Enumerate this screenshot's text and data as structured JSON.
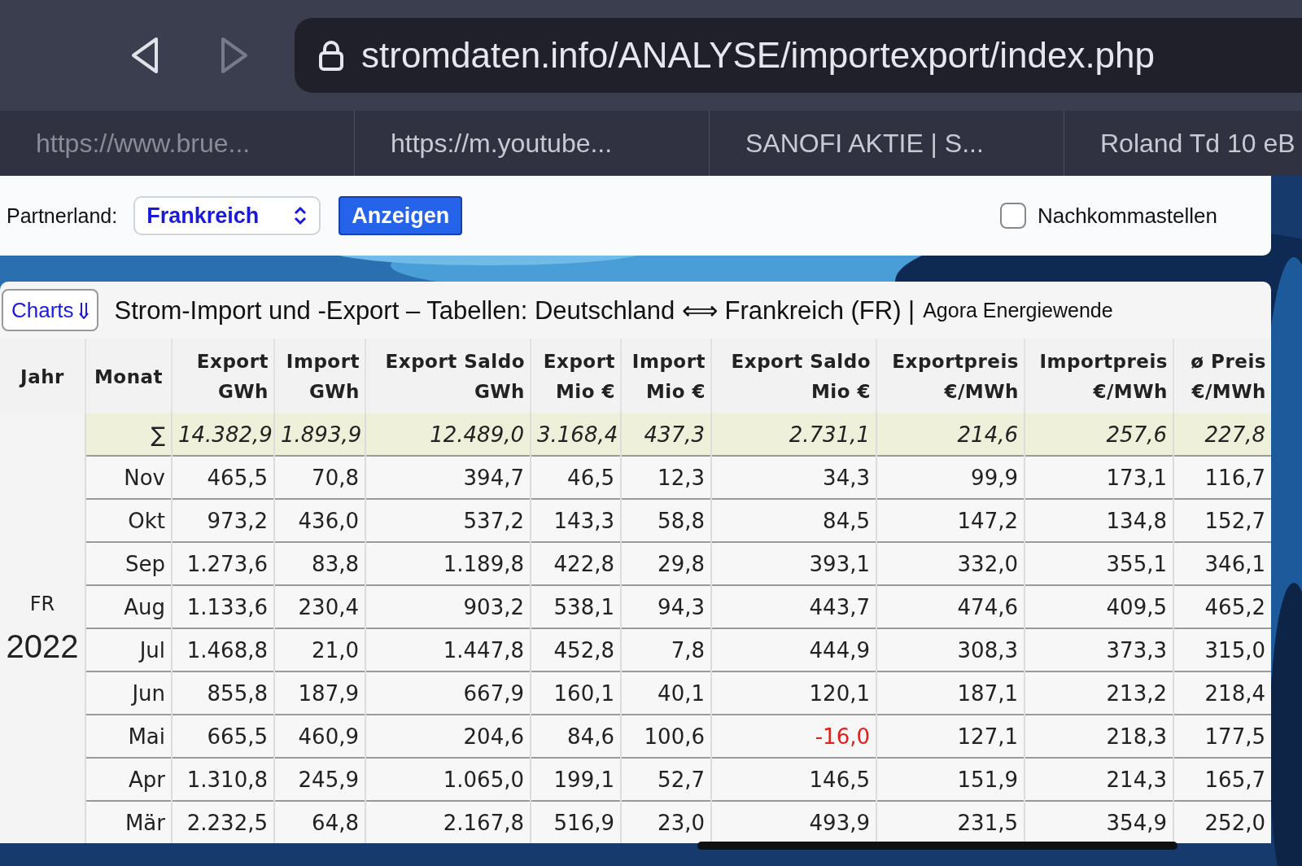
{
  "browser": {
    "url": "stromdaten.info/ANALYSE/importexport/index.php",
    "forward_disabled": true,
    "tabs": [
      {
        "label": "https://www.brue..."
      },
      {
        "label": "https://m.youtube..."
      },
      {
        "label": "SANOFI AKTIE | S..."
      },
      {
        "label": "Roland Td 10 eB"
      }
    ]
  },
  "form": {
    "partner_label": "Partnerland:",
    "partner_value": "Frankreich",
    "show_button": "Anzeigen",
    "decimals_label": "Nachkommastellen",
    "decimals_checked": false
  },
  "title_bar": {
    "charts_button": "Charts",
    "title": "Strom-Import und -Export – Tabellen: Deutschland ⟺ Frankreich (FR) |",
    "source": "Agora Energiewende"
  },
  "table": {
    "year_header": "Jahr",
    "month_header": "Monat",
    "columns": [
      {
        "line1": "Export",
        "line2": "GWh"
      },
      {
        "line1": "Import",
        "line2": "GWh"
      },
      {
        "line1": "Export Saldo",
        "line2": "GWh"
      },
      {
        "line1": "Export",
        "line2": "Mio €"
      },
      {
        "line1": "Import",
        "line2": "Mio €"
      },
      {
        "line1": "Export Saldo",
        "line2": "Mio €"
      },
      {
        "line1": "Exportpreis",
        "line2": "€/MWh"
      },
      {
        "line1": "Importpreis",
        "line2": "€/MWh"
      },
      {
        "line1": "ø Preis",
        "line2": "€/MWh"
      }
    ],
    "sum_row": {
      "label": "∑",
      "values": [
        "14.382,9",
        "1.893,9",
        "12.489,0",
        "3.168,4",
        "437,3",
        "2.731,1",
        "214,6",
        "257,6",
        "227,8"
      ]
    },
    "year": {
      "country": "FR",
      "year": "2022"
    },
    "rows": [
      {
        "month": "Nov",
        "values": [
          "465,5",
          "70,8",
          "394,7",
          "46,5",
          "12,3",
          "34,3",
          "99,9",
          "173,1",
          "116,7"
        ]
      },
      {
        "month": "Okt",
        "values": [
          "973,2",
          "436,0",
          "537,2",
          "143,3",
          "58,8",
          "84,5",
          "147,2",
          "134,8",
          "152,7"
        ]
      },
      {
        "month": "Sep",
        "values": [
          "1.273,6",
          "83,8",
          "1.189,8",
          "422,8",
          "29,8",
          "393,1",
          "332,0",
          "355,1",
          "346,1"
        ]
      },
      {
        "month": "Aug",
        "values": [
          "1.133,6",
          "230,4",
          "903,2",
          "538,1",
          "94,3",
          "443,7",
          "474,6",
          "409,5",
          "465,2"
        ]
      },
      {
        "month": "Jul",
        "values": [
          "1.468,8",
          "21,0",
          "1.447,8",
          "452,8",
          "7,8",
          "444,9",
          "308,3",
          "373,3",
          "315,0"
        ]
      },
      {
        "month": "Jun",
        "values": [
          "855,8",
          "187,9",
          "667,9",
          "160,1",
          "40,1",
          "120,1",
          "187,1",
          "213,2",
          "218,4"
        ]
      },
      {
        "month": "Mai",
        "values": [
          "665,5",
          "460,9",
          "204,6",
          "84,6",
          "100,6",
          {
            "text": "-16,0",
            "negative": true
          },
          "127,1",
          "218,3",
          "177,5"
        ]
      },
      {
        "month": "Apr",
        "values": [
          "1.310,8",
          "245,9",
          "1.065,0",
          "199,1",
          "52,7",
          "146,5",
          "151,9",
          "214,3",
          "165,7"
        ]
      },
      {
        "month": "Mär",
        "values": [
          "2.232,5",
          "64,8",
          "2.167,8",
          "516,9",
          "23,0",
          "493,9",
          "231,5",
          "354,9",
          "252,0"
        ]
      }
    ]
  }
}
